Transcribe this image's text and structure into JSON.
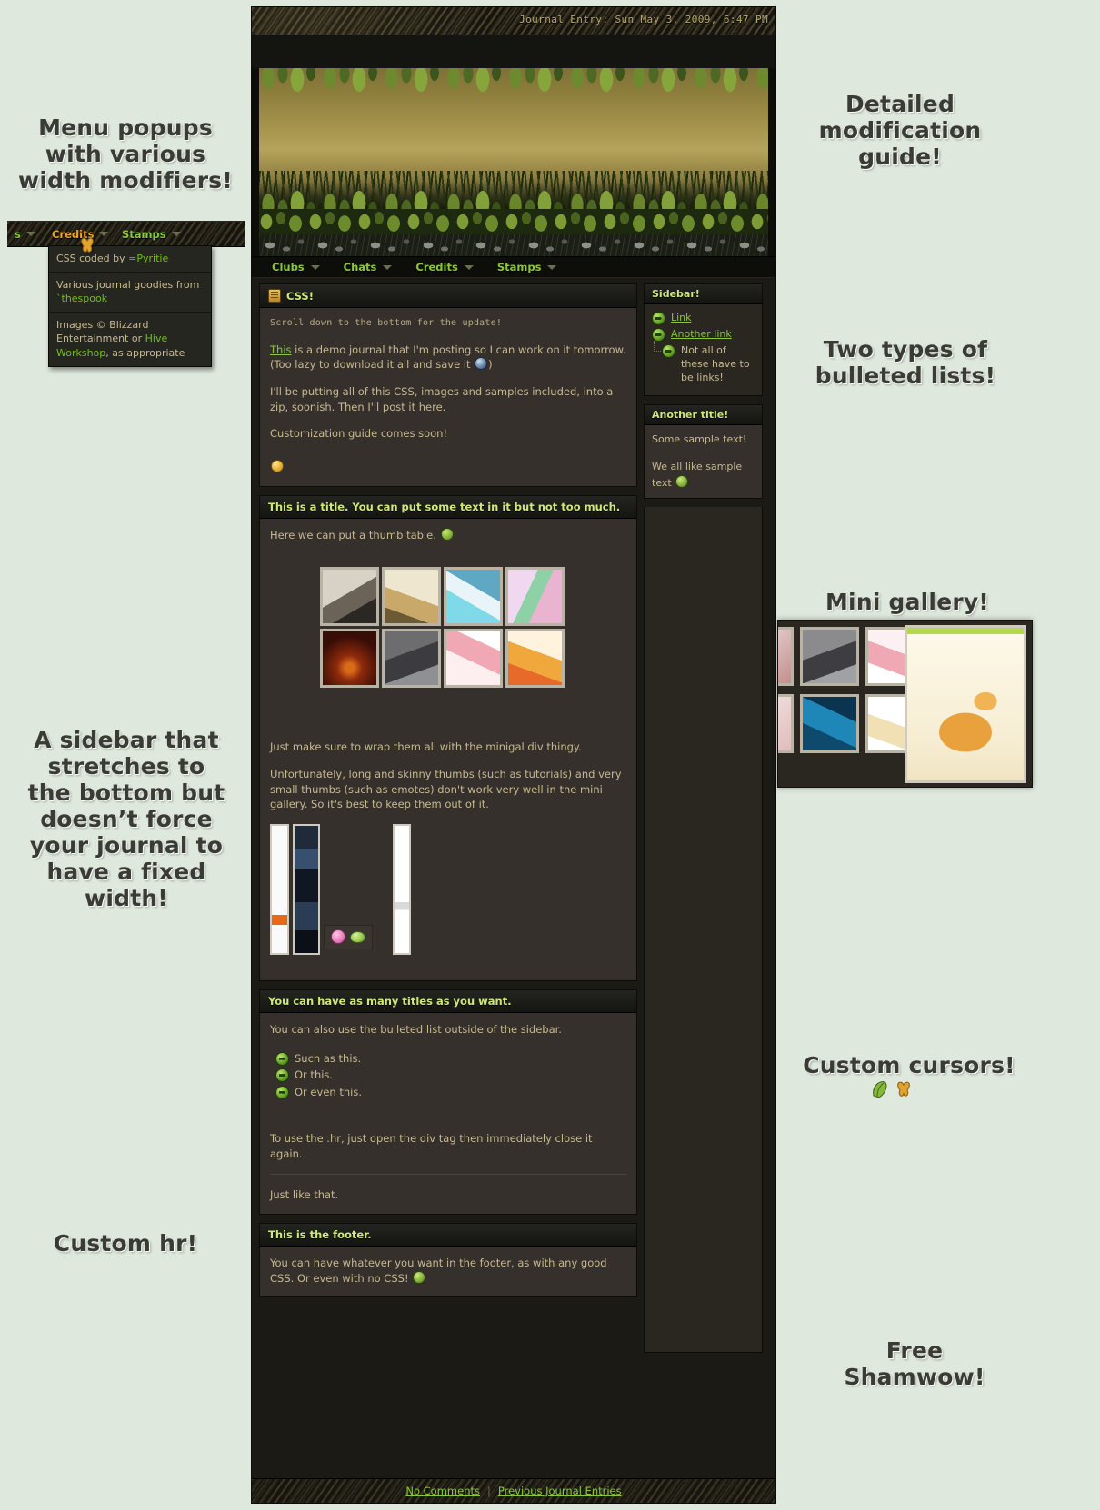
{
  "annotations": [
    {
      "id": "menu-popups",
      "text": "Menu popups\nwith various\nwidth modifiers!"
    },
    {
      "id": "sidebar-stretch",
      "text": "A sidebar that\nstretches to\nthe bottom but\ndoesn’t force\nyour journal to\nhave a fixed\nwidth!"
    },
    {
      "id": "custom-hr",
      "text": "Custom hr!"
    },
    {
      "id": "detailed-guide",
      "text": "Detailed\nmodification\nguide!"
    },
    {
      "id": "bulleted-lists",
      "text": "Two types of\nbulleted lists!"
    },
    {
      "id": "mini-gallery",
      "text": "Mini gallery!"
    },
    {
      "id": "custom-cursors",
      "text": "Custom cursors!"
    },
    {
      "id": "free-shamwow",
      "text": "Free\nShamwow!"
    }
  ],
  "journal": {
    "timestamp": "Journal Entry: Sun May 3, 2009, 6:47 PM",
    "nav": [
      {
        "label": "Clubs"
      },
      {
        "label": "Chats"
      },
      {
        "label": "Credits"
      },
      {
        "label": "Stamps"
      }
    ],
    "blocks": [
      {
        "icon": "scroll-icon",
        "title": "CSS!",
        "paragraphs": [
          "Scroll down to the bottom for the update!",
          "This is a demo journal that I'm posting so I can work on it tomorrow. (Too lazy to download it all and save it )",
          "I'll be putting all of this CSS, images and samples included, into a zip, soonish. Then I'll post it here.",
          "Customization guide comes soon!"
        ],
        "link_text": "This"
      },
      {
        "title": "This is a title. You can put some text in it but not too much.",
        "intro": "Here we can put a thumb table.",
        "after_gallery": "Just make sure to wrap them all with the minigal div thingy.",
        "note": "Unfortunately, long and skinny thumbs (such as tutorials) and very small thumbs (such as emotes) don't work very well in the mini gallery. So it's best to keep them out of it."
      },
      {
        "title": "You can have as many titles as you want.",
        "lead": "You can also use the bulleted list outside of the sidebar.",
        "bullets": [
          "Such as this.",
          "Or this.",
          "Or even this."
        ],
        "hr_note": "To use the .hr, just open the div tag then immediately close it again.",
        "after_hr": "Just like that."
      },
      {
        "title": "This is the footer.",
        "text": "You can have whatever you want in the footer, as with any good CSS. Or even with no CSS!"
      }
    ],
    "sidebar": [
      {
        "title": "Sidebar!",
        "items": [
          {
            "text": "Link",
            "link": true,
            "nested": false
          },
          {
            "text": "Another link",
            "link": true,
            "nested": false
          },
          {
            "text": "Not all of these have to be links!",
            "link": false,
            "nested": true
          }
        ]
      },
      {
        "title": "Another title!",
        "paragraphs": [
          "Some sample text!",
          "We all like sample text"
        ]
      }
    ],
    "footer_nav": {
      "comments": "No Comments",
      "separator": "|",
      "previous": "Previous Journal Entries"
    }
  },
  "popup_menu": {
    "bar": [
      {
        "label": "s",
        "color": "green"
      },
      {
        "label": "Credits",
        "color": "orange"
      },
      {
        "label": "Stamps",
        "color": "green"
      }
    ],
    "items": [
      {
        "pre": "CSS coded by ",
        "green": "=Pyritie",
        "post": ""
      },
      {
        "pre": "Various journal goodies from ",
        "green": "`thespook",
        "post": ""
      },
      {
        "pre": "Images © Blizzard Entertainment or ",
        "green": "Hive Workshop",
        "post": ", as appropriate"
      }
    ]
  },
  "colors": {
    "page_bg": "#dfe8dd",
    "accent_green": "#8cc63e",
    "title_green": "#cfe87a",
    "body_text": "#c8b98f",
    "panel_bg": "#35302b",
    "sidebar_bg": "#2a2620",
    "orange": "#e8a32a"
  }
}
